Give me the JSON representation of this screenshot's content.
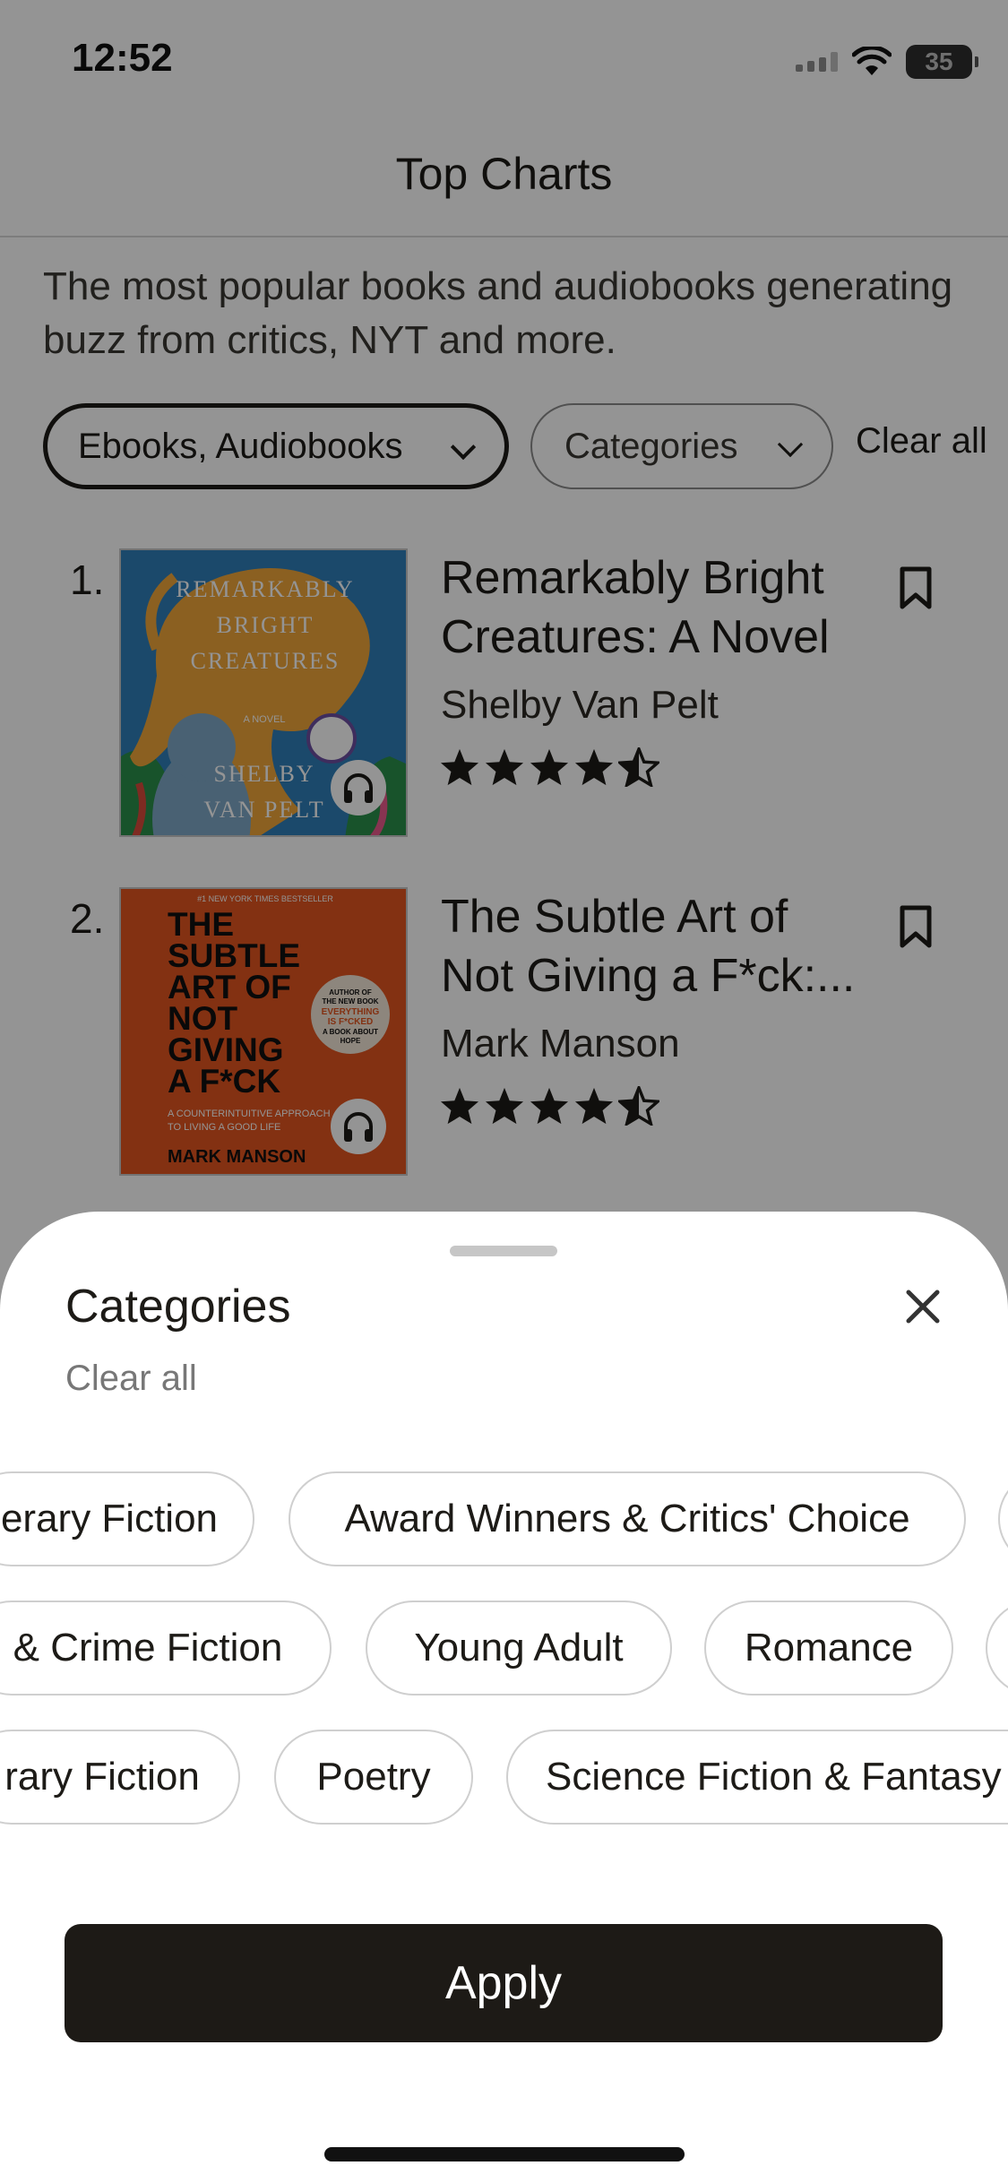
{
  "status_bar": {
    "time": "12:52",
    "battery": "35"
  },
  "header": {
    "title": "Top Charts",
    "subtitle": "The most popular books and audiobooks generating buzz from critics, NYT and more."
  },
  "filters": {
    "format_label": "Ebooks, Audiobooks",
    "categories_label": "Categories",
    "clear_all": "Clear all"
  },
  "books": [
    {
      "rank": "1.",
      "title_line1": "Remarkably Bright",
      "title_line2": "Creatures: A Novel",
      "author": "Shelby Van Pelt",
      "rating": 4.5,
      "cover": {
        "title_line1": "REMARKABLY",
        "title_line2": "BRIGHT",
        "title_line3": "CREATURES",
        "tag": "A NOVEL",
        "author_line1": "SHELBY",
        "author_line2": "VAN PELT",
        "colors": {
          "background": "#2f7fb8",
          "octopus": "#f0a63a"
        }
      }
    },
    {
      "rank": "2.",
      "title_line1": "The Subtle Art of",
      "title_line2": "Not Giving a F*ck:...",
      "author": "Mark Manson",
      "rating": 4.5,
      "cover": {
        "banner": "#1 NEW YORK TIMES BESTSELLER",
        "title_line1": "THE",
        "title_line2": "SUBTLE",
        "title_line3": "ART OF",
        "title_line4": "NOT",
        "title_line5": "GIVING",
        "title_line6": "A F*CK",
        "tagline_line1": "A COUNTERINTUITIVE APPROACH",
        "tagline_line2": "TO LIVING A GOOD LIFE",
        "author": "MARK MANSON",
        "badge_line1": "AUTHOR OF",
        "badge_line2": "THE NEW BOOK",
        "badge_line3": "EVERYTHING",
        "badge_line4": "IS F*CKED",
        "badge_line5": "A BOOK ABOUT",
        "badge_line6": "HOPE",
        "colors": {
          "background": "#e2551f"
        }
      }
    }
  ],
  "sheet": {
    "title": "Categories",
    "clear_all": "Clear all",
    "rows": [
      [
        "erary Fiction",
        "Award Winners & Critics' Choice"
      ],
      [
        "& Crime Fiction",
        "Young Adult",
        "Romance"
      ],
      [
        "rary Fiction",
        "Poetry",
        "Science Fiction & Fantasy"
      ]
    ],
    "apply_label": "Apply"
  },
  "icons": [
    "wifi-icon",
    "chevron-down-icon",
    "bookmark-icon",
    "star-icon",
    "half-star-icon",
    "headphones-icon",
    "close-icon"
  ]
}
